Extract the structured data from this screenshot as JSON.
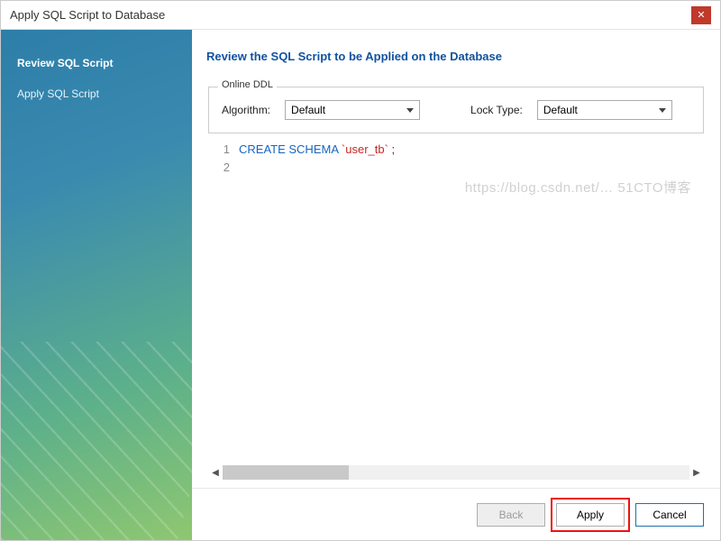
{
  "window": {
    "title": "Apply SQL Script to Database"
  },
  "sidebar": {
    "steps": [
      {
        "label": "Review SQL Script",
        "active": true
      },
      {
        "label": "Apply SQL Script",
        "active": false
      }
    ]
  },
  "main": {
    "heading": "Review the SQL Script to be Applied on the Database",
    "online_ddl": {
      "legend": "Online DDL",
      "algorithm_label": "Algorithm:",
      "algorithm_value": "Default",
      "lock_type_label": "Lock Type:",
      "lock_type_value": "Default"
    },
    "sql": {
      "lines": [
        "1",
        "2"
      ],
      "keyword": "CREATE SCHEMA",
      "identifier": "`user_tb`",
      "terminator": " ;"
    }
  },
  "footer": {
    "back": "Back",
    "apply": "Apply",
    "cancel": "Cancel"
  },
  "watermark": "https://blog.csdn.net/… 51CTO博客"
}
